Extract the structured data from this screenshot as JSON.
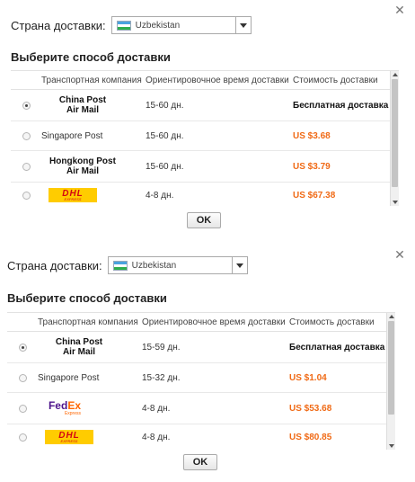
{
  "dialog1": {
    "country_label": "Страна доставки:",
    "country_value": "Uzbekistan",
    "section_title": "Выберите способ доставки",
    "columns": [
      "Транспортная компания",
      "Ориентировочное время доставки",
      "Стоимость доставки"
    ],
    "rows": [
      {
        "carrier_line1": "China Post",
        "carrier_line2": "Air Mail",
        "time": "15-60 дн.",
        "cost": "Бесплатная доставка",
        "selected": true
      },
      {
        "carrier": "Singapore Post",
        "time": "15-60 дн.",
        "cost": "US $3.68"
      },
      {
        "carrier_line1": "Hongkong Post",
        "carrier_line2": "Air Mail",
        "time": "15-60 дн.",
        "cost": "US $3.79"
      },
      {
        "logo": "DHL",
        "logo_sub": "EXPRESS",
        "time": "4-8 дн.",
        "cost": "US $67.38"
      }
    ],
    "ok_label": "OK"
  },
  "dialog2": {
    "country_label": "Страна доставки:",
    "country_value": "Uzbekistan",
    "section_title": "Выберите способ доставки",
    "columns": [
      "Транспортная компания",
      "Ориентировочное время доставки",
      "Стоимость доставки"
    ],
    "rows": [
      {
        "carrier_line1": "China Post",
        "carrier_line2": "Air Mail",
        "time": "15-59 дн.",
        "cost": "Бесплатная доставка",
        "selected": true
      },
      {
        "carrier": "Singapore Post",
        "time": "15-32 дн.",
        "cost": "US $1.04"
      },
      {
        "logo_fed": "Fed",
        "logo_ex": "Ex",
        "logo_sub": "Express",
        "time": "4-8 дн.",
        "cost": "US $53.68"
      },
      {
        "logo": "DHL",
        "logo_sub": "EXPRESS",
        "time": "4-8 дн.",
        "cost": "US $80.85"
      }
    ],
    "ok_label": "OK"
  },
  "colors": {
    "price_orange": "#f06a16",
    "dhl_yellow": "#ffcc00",
    "dhl_red": "#d40511",
    "fedex_purple": "#4d148c",
    "fedex_orange": "#ff6600"
  },
  "icons": {
    "close": "close-icon",
    "dropdown": "chevron-down-icon",
    "flag": "uzbekistan-flag-icon"
  }
}
